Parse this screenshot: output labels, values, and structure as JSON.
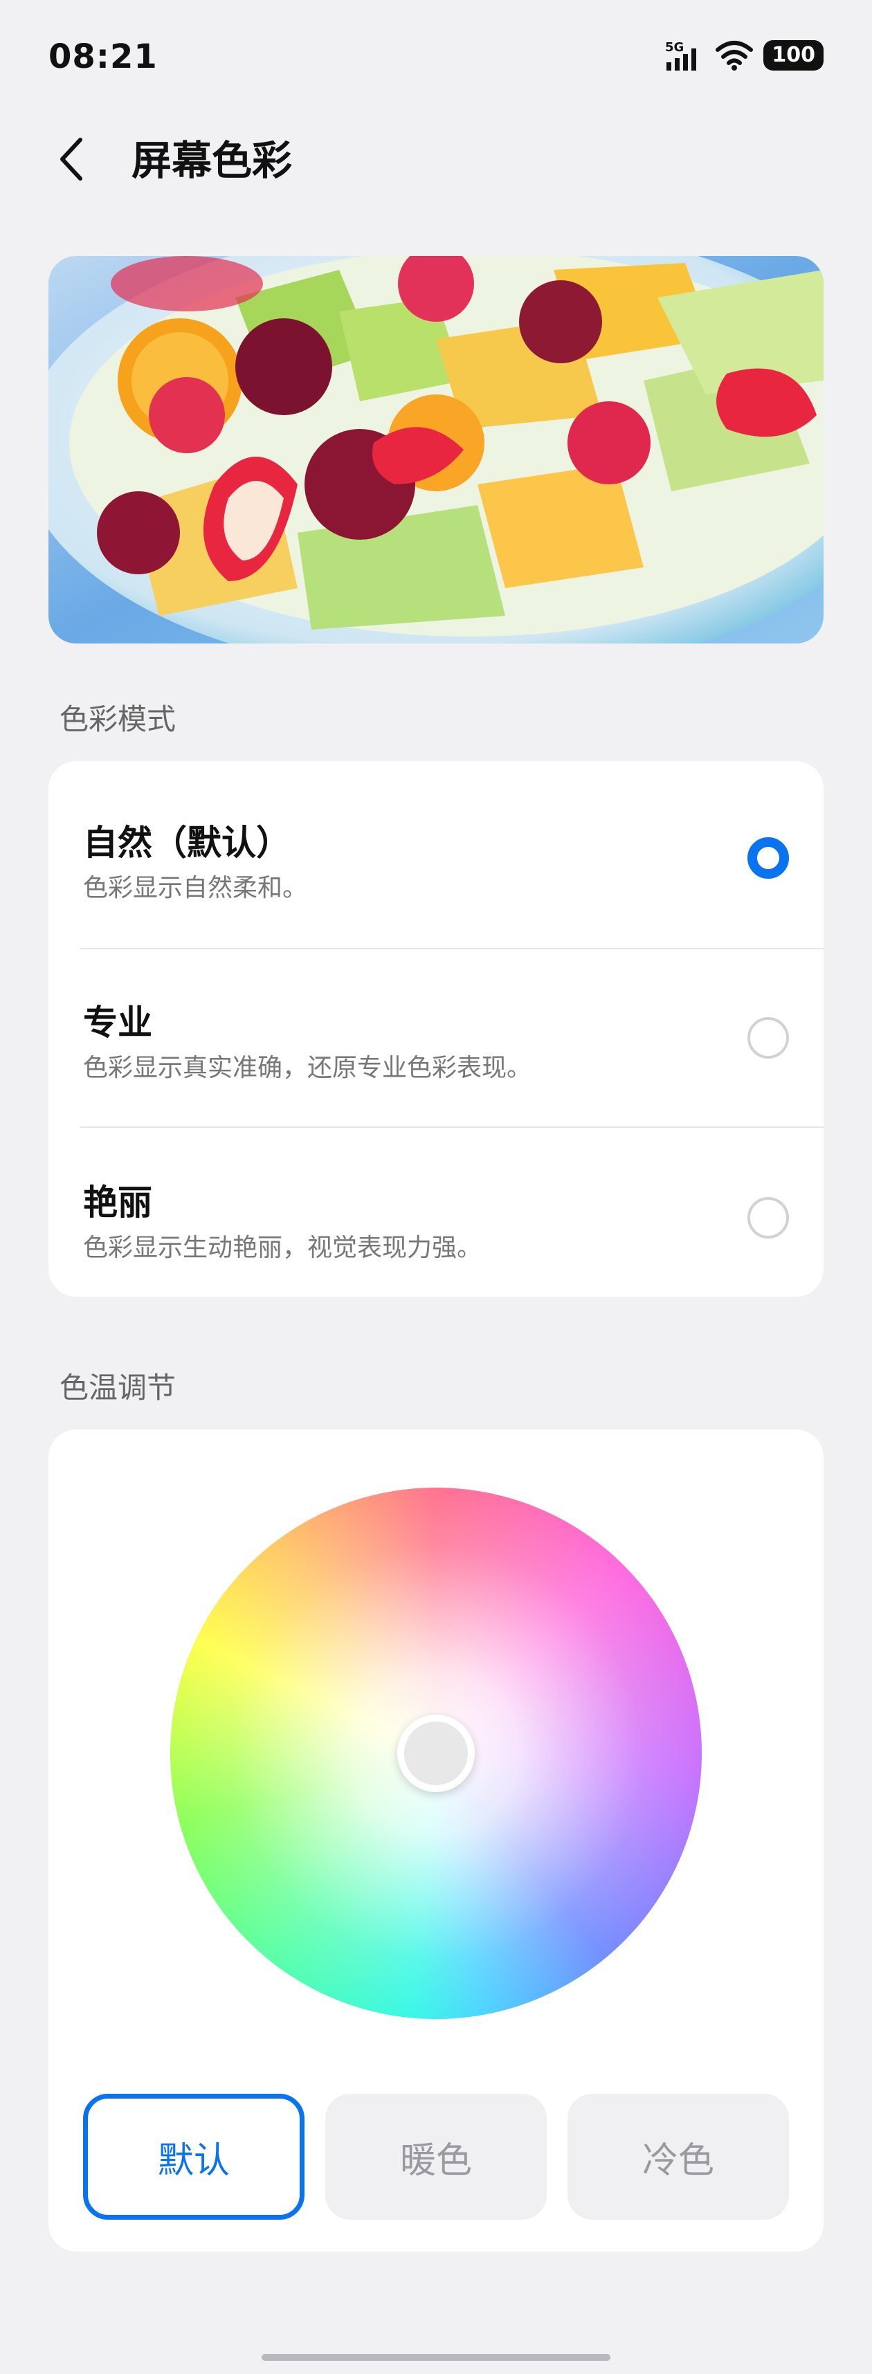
{
  "status_bar": {
    "time": "08:21",
    "network": "5G",
    "battery": "100",
    "icons": [
      "signal-icon",
      "wifi-icon",
      "battery-icon"
    ]
  },
  "header": {
    "title": "屏幕色彩",
    "back_icon": "chevron-left-icon"
  },
  "color_mode": {
    "section_title": "色彩模式",
    "options": [
      {
        "title": "自然（默认）",
        "description": "色彩显示自然柔和。",
        "selected": true
      },
      {
        "title": "专业",
        "description": "色彩显示真实准确，还原专业色彩表现。",
        "selected": false
      },
      {
        "title": "艳丽",
        "description": "色彩显示生动艳丽，视觉表现力强。",
        "selected": false
      }
    ]
  },
  "color_temperature": {
    "section_title": "色温调节",
    "buttons": [
      {
        "label": "默认",
        "active": true
      },
      {
        "label": "暖色",
        "active": false
      },
      {
        "label": "冷色",
        "active": false
      }
    ]
  },
  "colors": {
    "accent": "#0a74f0",
    "background": "#f1f1f3",
    "card": "#ffffff"
  }
}
